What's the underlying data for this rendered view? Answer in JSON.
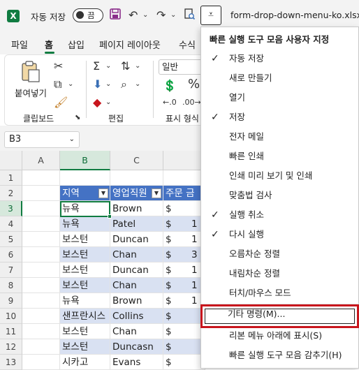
{
  "titlebar": {
    "app_logo": "X",
    "autosave_label": "자동 저장",
    "autosave_state": "끔",
    "filename": "form-drop-down-menu-ko.xlsx ∨",
    "qat_button_glyph": "⩡"
  },
  "tabs": [
    "파일",
    "홈",
    "삽입",
    "페이지 레이아웃",
    "수식"
  ],
  "ribbon": {
    "paste_label": "붙여넣기",
    "clipboard_group": "클립보드",
    "edit_group": "편집",
    "format_group_label": "표시 형식",
    "number_format": "일반",
    "percent": "%"
  },
  "formula_bar": {
    "namebox": "B3"
  },
  "grid": {
    "columns": [
      "A",
      "B",
      "C"
    ],
    "rows": [
      "1",
      "2",
      "3",
      "4",
      "5",
      "6",
      "7",
      "8",
      "9",
      "10",
      "11",
      "12",
      "13"
    ],
    "table_headers": [
      "지역",
      "영업직원",
      "주문 금"
    ],
    "table_rows": [
      {
        "region": "뉴욕",
        "rep": "Brown",
        "amt": "$"
      },
      {
        "region": "뉴욕",
        "rep": "Patel",
        "amt": "$"
      },
      {
        "region": "보스턴",
        "rep": "Duncan",
        "amt": "$"
      },
      {
        "region": "보스턴",
        "rep": "Chan",
        "amt": "$"
      },
      {
        "region": "보스턴",
        "rep": "Duncan",
        "amt": "$"
      },
      {
        "region": "보스턴",
        "rep": "Chan",
        "amt": "$"
      },
      {
        "region": "뉴욕",
        "rep": "Brown",
        "amt": "$"
      },
      {
        "region": "샌프란시스",
        "rep": "Collins",
        "amt": "$"
      },
      {
        "region": "보스턴",
        "rep": "Chan",
        "amt": "$"
      },
      {
        "region": "보스턴",
        "rep": "Duncasn",
        "amt": "$"
      },
      {
        "region": "시카고",
        "rep": "Evans",
        "amt": "$"
      }
    ],
    "partial_values": [
      "1",
      "1",
      "3",
      "1",
      "1",
      "1"
    ]
  },
  "menu": {
    "title": "빠른 실행 도구 모음 사용자 지정",
    "items": [
      {
        "label": "자동 저장",
        "checked": "✓"
      },
      {
        "label": "새로 만들기",
        "checked": ""
      },
      {
        "label": "열기",
        "checked": ""
      },
      {
        "label": "저장",
        "checked": "✓"
      },
      {
        "label": "전자 메일",
        "checked": ""
      },
      {
        "label": "빠른 인쇄",
        "checked": ""
      },
      {
        "label": "인쇄 미리 보기 및 인쇄",
        "checked": ""
      },
      {
        "label": "맞춤법 검사",
        "checked": ""
      },
      {
        "label": "실행 취소",
        "checked": "✓"
      },
      {
        "label": "다시 실행",
        "checked": "✓"
      },
      {
        "label": "오름차순 정렬",
        "checked": ""
      },
      {
        "label": "내림차순 정렬",
        "checked": ""
      },
      {
        "label": "터치/마우스 모드",
        "checked": ""
      },
      {
        "label": "기타 명령(M)...",
        "checked": ""
      },
      {
        "label": "리본 메뉴 아래에 표시(S)",
        "checked": ""
      },
      {
        "label": "빠른 실행 도구 모음 감추기(H)",
        "checked": ""
      }
    ]
  },
  "colors": {
    "excel_green": "#107c41",
    "table_header": "#4472c4",
    "table_band": "#d9e1f2",
    "highlight_border": "#c8161d"
  }
}
